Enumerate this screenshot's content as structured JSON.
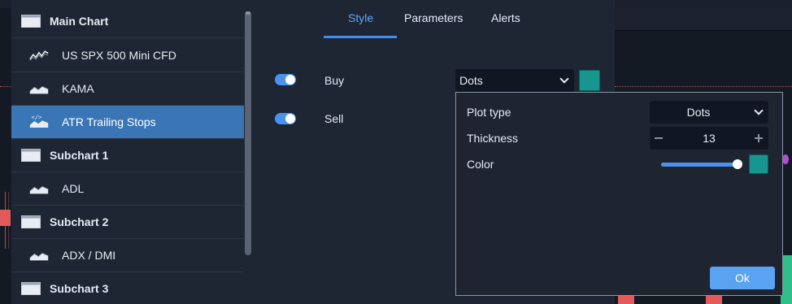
{
  "sidebar": {
    "items": [
      {
        "label": "Main Chart",
        "type": "group",
        "icon": "chart-window-icon"
      },
      {
        "label": "US SPX 500 Mini CFD",
        "type": "child",
        "icon": "line-series-icon"
      },
      {
        "label": "KAMA",
        "type": "child",
        "icon": "area-series-icon"
      },
      {
        "label": "ATR Trailing Stops",
        "type": "child",
        "icon": "code-indicator-icon",
        "active": true
      },
      {
        "label": "Subchart 1",
        "type": "group",
        "icon": "chart-window-icon"
      },
      {
        "label": "ADL",
        "type": "child",
        "icon": "area-series-icon"
      },
      {
        "label": "Subchart 2",
        "type": "group",
        "icon": "chart-window-icon"
      },
      {
        "label": "ADX / DMI",
        "type": "child",
        "icon": "area-series-icon"
      },
      {
        "label": "Subchart 3",
        "type": "group",
        "icon": "chart-window-icon"
      }
    ]
  },
  "tabs": [
    {
      "label": "Style",
      "active": true
    },
    {
      "label": "Parameters"
    },
    {
      "label": "Alerts"
    }
  ],
  "style": {
    "rows": [
      {
        "label": "Buy",
        "enabled": true,
        "plot_type": "Dots",
        "color": "#17968f"
      },
      {
        "label": "Sell",
        "enabled": true
      }
    ]
  },
  "popup": {
    "plot_type_label": "Plot type",
    "plot_type_value": "Dots",
    "thickness_label": "Thickness",
    "thickness_value": "13",
    "color_label": "Color",
    "color_value": "#17968f",
    "opacity_fraction": 1.0,
    "ok_label": "Ok"
  },
  "colors": {
    "accent": "#3f8ef0",
    "active_item": "#3a76b5",
    "dialog_bg": "#1f2633",
    "swatch": "#17968f"
  }
}
